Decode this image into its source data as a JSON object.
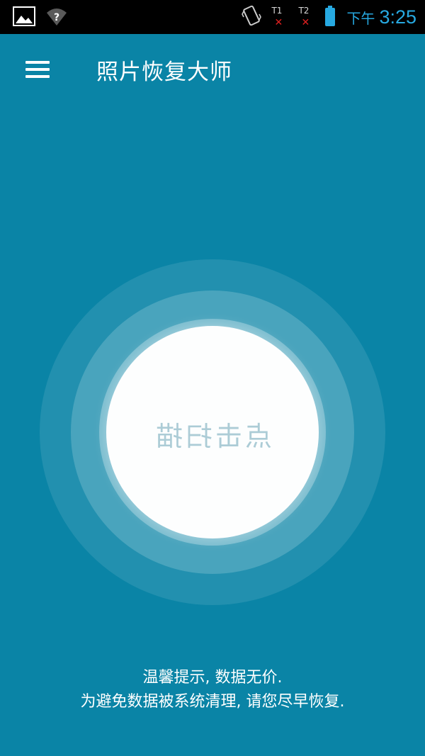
{
  "status_bar": {
    "left_icons": [
      "image-icon",
      "wifi-unknown-icon"
    ],
    "right_icons": [
      "vibrate-icon",
      "sim1-no-signal-icon",
      "sim2-no-signal-icon",
      "battery-icon"
    ],
    "sim1_label": "T1",
    "sim2_label": "T2",
    "ampm": "下午",
    "time": "3:25",
    "accent_color": "#27a9e1"
  },
  "app_bar": {
    "menu_icon": "hamburger-menu-icon",
    "title": "照片恢复大师"
  },
  "scan": {
    "button_label": "点击扫描"
  },
  "tips": {
    "line1": "温馨提示, 数据无价.",
    "line2": "为避免数据被系统清理, 请您尽早恢复."
  },
  "colors": {
    "background": "#0a84a6",
    "status_bar": "#000000",
    "scan_button": "#fdfefe"
  }
}
